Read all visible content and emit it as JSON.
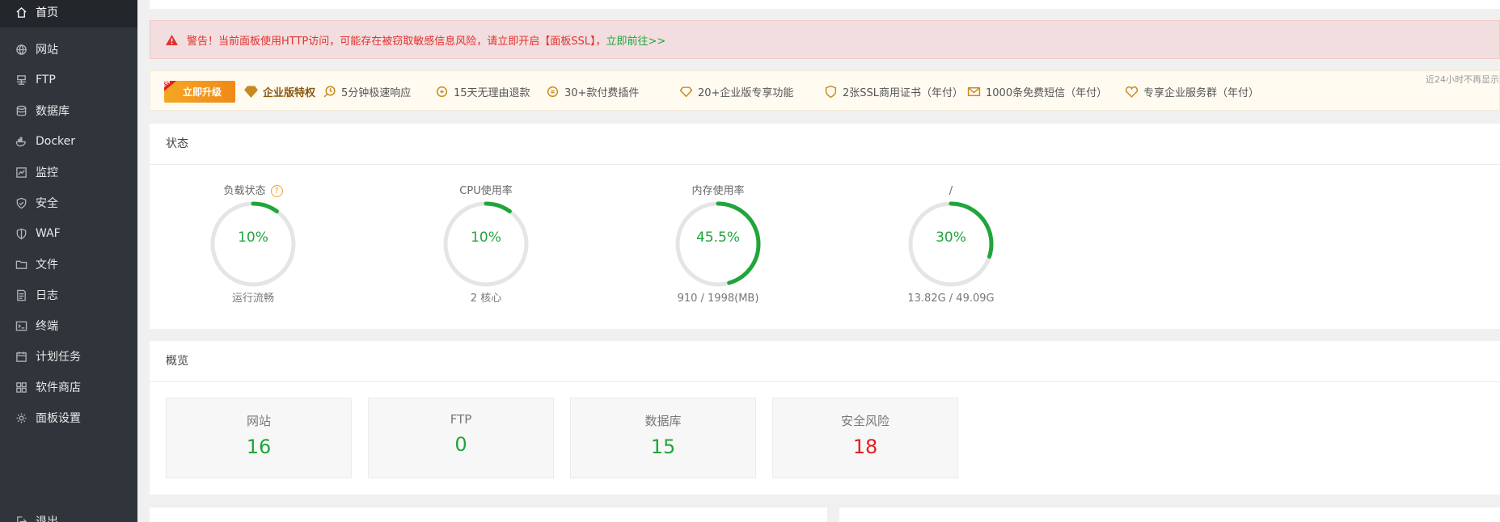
{
  "sidebar": {
    "items": [
      {
        "label": "首页",
        "icon": "home-icon",
        "active": true
      },
      {
        "label": "网站",
        "icon": "globe-icon"
      },
      {
        "label": "FTP",
        "icon": "ftp-icon"
      },
      {
        "label": "数据库",
        "icon": "database-icon"
      },
      {
        "label": "Docker",
        "icon": "docker-icon"
      },
      {
        "label": "监控",
        "icon": "monitor-icon"
      },
      {
        "label": "安全",
        "icon": "shield-icon"
      },
      {
        "label": "WAF",
        "icon": "waf-shield-icon"
      },
      {
        "label": "文件",
        "icon": "folder-icon"
      },
      {
        "label": "日志",
        "icon": "log-icon"
      },
      {
        "label": "终端",
        "icon": "terminal-icon"
      },
      {
        "label": "计划任务",
        "icon": "calendar-icon"
      },
      {
        "label": "软件商店",
        "icon": "apps-grid-icon"
      },
      {
        "label": "面板设置",
        "icon": "gear-icon"
      },
      {
        "label": "退出",
        "icon": "logout-icon"
      }
    ]
  },
  "alert": {
    "text": "警告！当前面板使用HTTP访问，可能存在被窃取敏感信息风险，请立即开启【面板SSL】，",
    "link": "立即前往>>"
  },
  "promo": {
    "tag": "推荐",
    "button": "立即升级",
    "headline": "企业版特权",
    "features": [
      "5分钟极速响应",
      "15天无理由退款",
      "30+款付费插件",
      "20+企业版专享功能",
      "2张SSL商用证书（年付）",
      "1000条免费短信（年付）",
      "专享企业服务群（年付）"
    ],
    "note": "近24小时不再显示"
  },
  "status": {
    "title": "状态",
    "gauges": [
      {
        "label": "负载状态",
        "value": "10%",
        "percent": 10,
        "sub": "运行流畅",
        "help": "?"
      },
      {
        "label": "CPU使用率",
        "value": "10%",
        "percent": 10,
        "sub": "2 核心"
      },
      {
        "label": "内存使用率",
        "value": "45.5%",
        "percent": 45.5,
        "sub": "910 / 1998(MB)"
      },
      {
        "label": "/",
        "value": "30%",
        "percent": 30,
        "sub": "13.82G / 49.09G"
      }
    ]
  },
  "overview": {
    "title": "概览",
    "boxes": [
      {
        "label": "网站",
        "value": "16"
      },
      {
        "label": "FTP",
        "value": "0"
      },
      {
        "label": "数据库",
        "value": "15"
      },
      {
        "label": "安全风险",
        "value": "18"
      }
    ]
  },
  "colors": {
    "accent": "#20a53a",
    "danger": "#e02020",
    "sidebar": "#30353b"
  }
}
